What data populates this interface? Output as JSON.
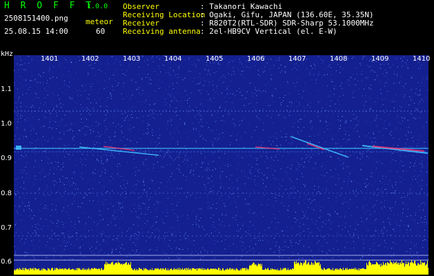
{
  "app": {
    "title": "H R O F F T",
    "version": "1.0.0"
  },
  "file": {
    "name": "2508151400.png",
    "datetime": "25.08.15 14:00"
  },
  "meteor": {
    "label": "meteor",
    "count": "60"
  },
  "info": {
    "rows": [
      {
        "label": "Observer",
        "value": ": Takanori Kawachi"
      },
      {
        "label": "Receiving Location",
        "value": ": Ogaki, Gifu, JAPAN (136.60E, 35.35N)"
      },
      {
        "label": "Receiver",
        "value": ": R820T2(RTL-SDR) SDR-Sharp 53.1000MHz"
      },
      {
        "label": "Receiving antenna",
        "value": ": 2el-HB9CV Vertical (el. E-W)"
      }
    ]
  },
  "axis": {
    "unit": "kHz",
    "y_ticks": [
      "1.1",
      "1.0",
      "0.9",
      "0.8",
      "0.7",
      "0.6"
    ],
    "x_ticks": [
      "1401",
      "1402",
      "1403",
      "1404",
      "1405",
      "1406",
      "1407",
      "1408",
      "1409",
      "1410"
    ]
  },
  "colors": {
    "background": "#14208f",
    "carrier": "#40c0ff",
    "echo": "#ff3070",
    "baseline": "#ffff00",
    "label_green": "#00ff00",
    "label_yellow": "#ffff00"
  }
}
